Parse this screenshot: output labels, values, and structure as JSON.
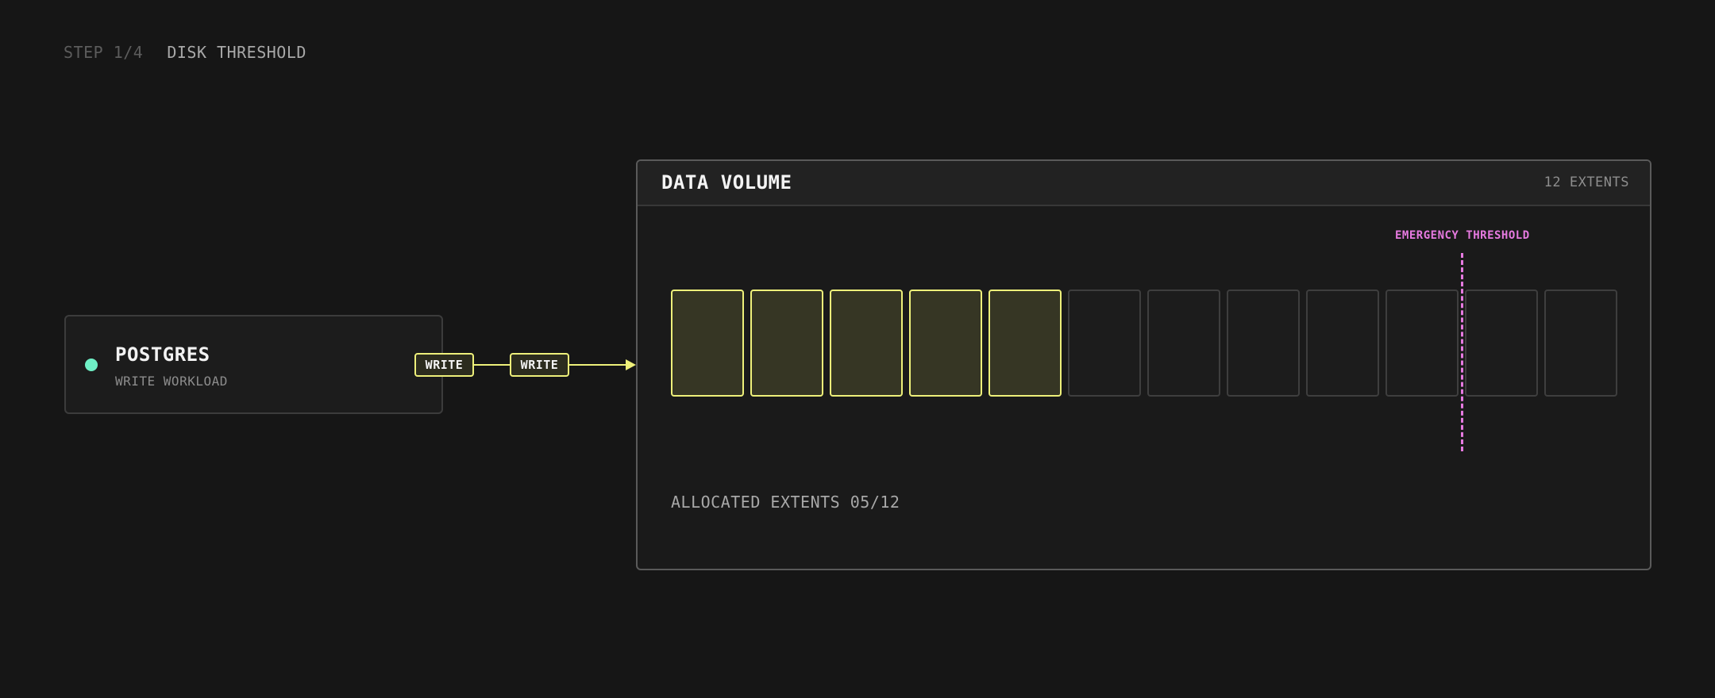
{
  "step": {
    "number": "STEP 1/4",
    "title": "DISK THRESHOLD"
  },
  "source": {
    "name": "POSTGRES",
    "subtitle": "WRITE WORKLOAD",
    "status_color": "#6ff0c6"
  },
  "flow": {
    "labels": [
      "WRITE",
      "WRITE"
    ],
    "color": "#eef07a"
  },
  "volume": {
    "title": "DATA VOLUME",
    "extent_count_label": "12 EXTENTS",
    "total_extents": 12,
    "allocated_extents": 5,
    "threshold_label": "EMERGENCY THRESHOLD",
    "threshold_after_extent": 9,
    "threshold_color": "#e67ae0",
    "allocated_label": "ALLOCATED EXTENTS 05/12"
  }
}
